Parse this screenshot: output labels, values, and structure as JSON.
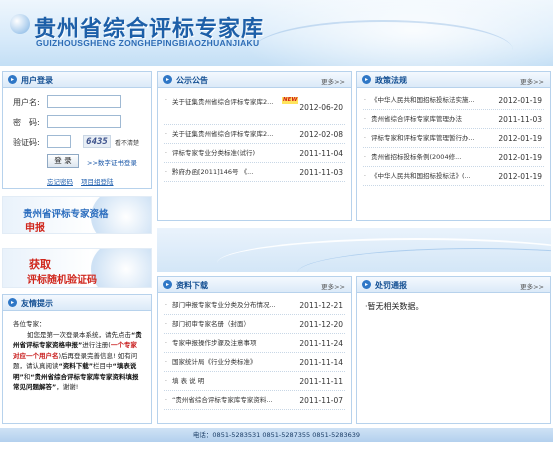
{
  "header": {
    "title": "贵州省综合评标专家库",
    "subtitle": "GUIZHOUSGHENG ZONGHEPINGBIAOZHUANJIAKU"
  },
  "login": {
    "title": "用户登录",
    "username_label": "用户名:",
    "password_label": "密　码:",
    "captcha_label": "验证码:",
    "captcha_value": "6435",
    "captcha_refresh": "看不清楚",
    "login_button": "登 录",
    "cert_login": ">>数字证书登录",
    "forgot_password": "忘记密码",
    "project_login": "项目组登陆"
  },
  "promos": {
    "apply_line1": "贵州省评标专家资格",
    "apply_line2": "申报",
    "random_line1": "获取",
    "random_line2": "评标随机验证码"
  },
  "tips": {
    "title": "友情提示",
    "greeting": "各位专家：",
    "p1a": "如您是第一次登录本系统，请先点击",
    "p1b": "“贵州省评标专家资格申报”",
    "p1c": "进行注册(",
    "p1d": "一个专家对应一个用户名",
    "p1e": ")后再登录完善信息! 如有问题，请认真阅读",
    "p1f": "“资料下载”",
    "p1g": "栏目中",
    "p1h": "“填表说明”",
    "p1i": "和",
    "p1j": "“贵州省综合评标专家库专家资料填报常见问题解答”",
    "p1k": "，谢谢!"
  },
  "notices": {
    "title": "公示公告",
    "more": "更多>>",
    "new_badge": "NEW",
    "items": [
      {
        "text": "关于征集贵州省综合评标专家库2...",
        "date": "2012-06-20",
        "new": true
      },
      {
        "text": "关于征集贵州省综合评标专家库2...",
        "date": "2012-02-08",
        "new": false
      },
      {
        "text": "评标专家专业分类标准(试行)",
        "date": "2011-11-04",
        "new": false
      },
      {
        "text": "黔府办函[2011]146号 《...",
        "date": "2011-11-03",
        "new": false
      }
    ]
  },
  "policies": {
    "title": "政策法规",
    "more": "更多>>",
    "items": [
      {
        "text": "《中华人民共和国招标投标法实施...",
        "date": "2012-01-19"
      },
      {
        "text": "贵州省综合评标专家库管理办法",
        "date": "2011-11-03"
      },
      {
        "text": "评标专家和评标专家库管理暂行办...",
        "date": "2012-01-19"
      },
      {
        "text": "贵州省招标投标条例(2004修...",
        "date": "2012-01-19"
      },
      {
        "text": "《中华人民共和国招标投标法》(...",
        "date": "2012-01-19"
      }
    ]
  },
  "downloads": {
    "title": "资料下载",
    "more": "更多>>",
    "items": [
      {
        "text": "部门申报专家专业分类及分布情况...",
        "date": "2011-12-21"
      },
      {
        "text": "部门初审专家名册（封面）",
        "date": "2011-12-20"
      },
      {
        "text": "专家申报操作步骤及注意事项",
        "date": "2011-11-24"
      },
      {
        "text": "国家统计局《行业分类标准》",
        "date": "2011-11-14"
      },
      {
        "text": "填 表 说 明",
        "date": "2011-11-11"
      },
      {
        "text": "“贵州省综合评标专家库专家资料...",
        "date": "2011-11-07"
      }
    ]
  },
  "penalties": {
    "title": "处罚通报",
    "more": "更多>>",
    "empty": "·暂无相关数据。"
  },
  "footer": {
    "phones": "电话：0851-5283531 0851-5287355 0851-5283639"
  }
}
